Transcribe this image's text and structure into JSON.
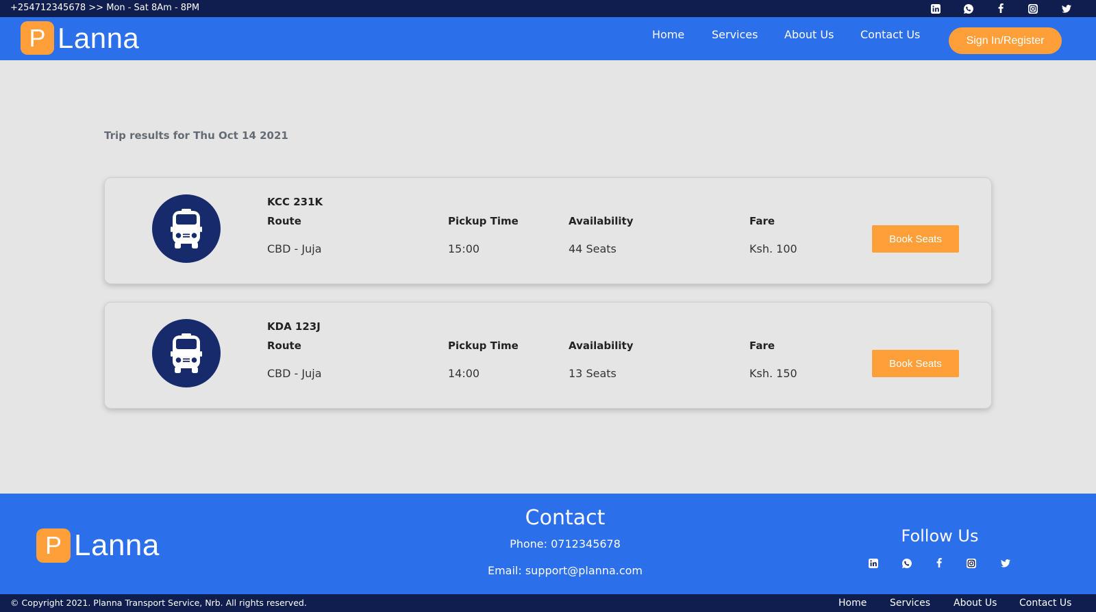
{
  "topbar": {
    "contact_text": "+254712345678 >> Mon - Sat 8Am - 8PM",
    "socials": [
      "linkedin-icon",
      "whatsapp-icon",
      "facebook-icon",
      "instagram-icon",
      "twitter-icon"
    ]
  },
  "brand": {
    "mark": "P",
    "word": "Lanna",
    "accent_color": "#ff9f3a",
    "primary_color": "#2c6fea",
    "dark_color": "#101e4f"
  },
  "nav": {
    "links": [
      "Home",
      "Services",
      "About Us",
      "Contact Us"
    ],
    "signin_label": "Sign In/Register"
  },
  "results": {
    "title": "Trip results for Thu Oct 14 2021",
    "headers": {
      "route": "Route",
      "pickup": "Pickup Time",
      "availability": "Availability",
      "fare": "Fare"
    },
    "book_label": "Book Seats",
    "trips": [
      {
        "plate": "KCC 231K",
        "route": "CBD - Juja",
        "pickup": "15:00",
        "availability": "44 Seats",
        "fare": "Ksh. 100"
      },
      {
        "plate": "KDA 123J",
        "route": "CBD - Juja",
        "pickup": "14:00",
        "availability": "13 Seats",
        "fare": "Ksh. 150"
      }
    ]
  },
  "footer": {
    "contact_title": "Contact",
    "phone": "Phone: 0712345678",
    "email": "Email: support@planna.com",
    "follow_title": "Follow Us",
    "copyright": "© Copyright 2021. Planna Transport Service, Nrb. All rights reserved.",
    "links": [
      "Home",
      "Services",
      "About Us",
      "Contact Us"
    ]
  }
}
